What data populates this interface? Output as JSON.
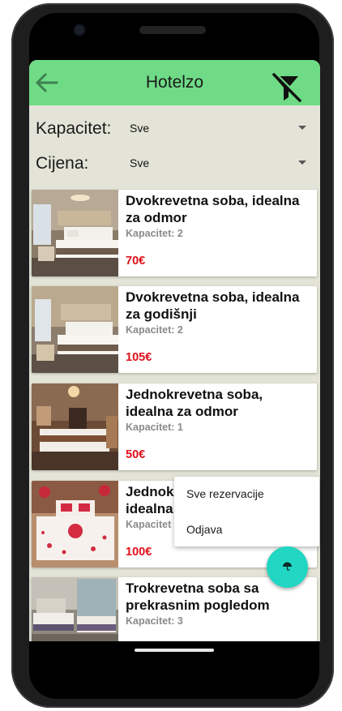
{
  "app": {
    "title": "Hotelzo"
  },
  "filters": [
    {
      "label": "Kapacitet:",
      "value": "Sve"
    },
    {
      "label": "Cijena:",
      "value": "Sve"
    }
  ],
  "rooms": [
    {
      "title_line1": "Dvokrevetna soba, idealna",
      "title_line2": "za odmor",
      "capacity": "Kapacitet: 2",
      "price": "70€"
    },
    {
      "title_line1": "Dvokrevetna soba, idealna",
      "title_line2": "za godišnji",
      "capacity": "Kapacitet: 2",
      "price": "105€"
    },
    {
      "title_line1": "Jednokrevetna soba,",
      "title_line2": "idealna za odmor",
      "capacity": "Kapacitet: 1",
      "price": "50€"
    },
    {
      "title_line1": "Jednok",
      "title_line2": "idealna",
      "capacity": "Kapacitet",
      "price": "100€"
    },
    {
      "title_line1": "Trokrevetna soba sa",
      "title_line2": "prekrasnim pogledom",
      "capacity": "Kapacitet: 3",
      "price": ""
    }
  ],
  "menu": {
    "items": [
      "Sve rezervacije",
      "Odjava"
    ]
  },
  "colors": {
    "appbar": "#6fdb86",
    "background": "#e3e4d7",
    "price": "#e0101a",
    "fab": "#21d6c2"
  },
  "icons": {
    "back": "arrow-left-icon",
    "filter": "filter-off-icon",
    "fab": "umbrella-icon"
  }
}
